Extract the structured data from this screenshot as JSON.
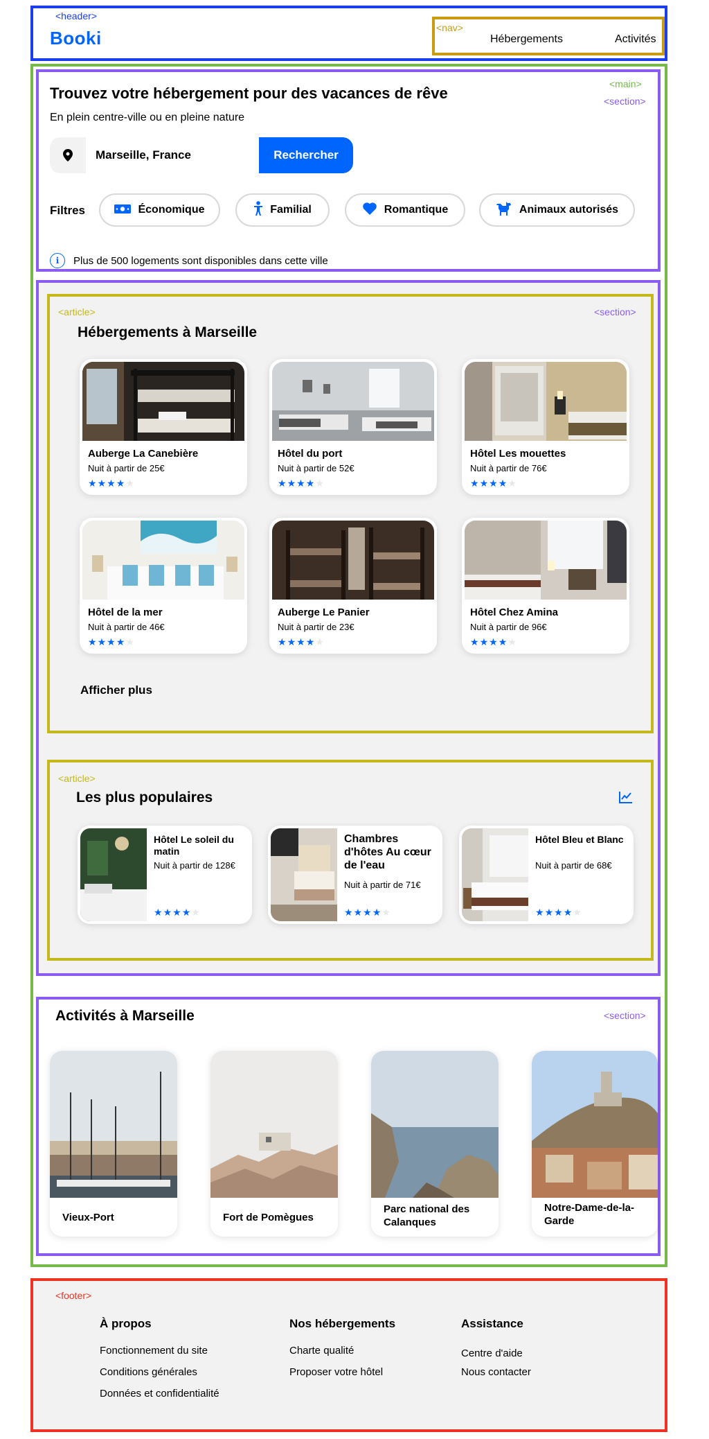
{
  "tags": {
    "header": "<header>",
    "nav": "<nav>",
    "main": "<main>",
    "section": "<section>",
    "article": "<article>",
    "footer": "<footer>"
  },
  "header": {
    "logo": "Booki",
    "nav": [
      "Hébergements",
      "Activités"
    ]
  },
  "search": {
    "title": "Trouvez votre hébergement pour des vacances de rêve",
    "subtitle": "En plein centre-ville ou en pleine nature",
    "input_value": "Marseille, France",
    "button_label": "Rechercher",
    "filters_label": "Filtres",
    "filters": [
      "Économique",
      "Familial",
      "Romantique",
      "Animaux autorisés"
    ],
    "info": "Plus de 500 logements sont disponibles dans cette ville",
    "info_icon": "i"
  },
  "accommodations": {
    "title": "Hébergements à Marseille",
    "cards": [
      {
        "name": "Auberge La Canebière",
        "price": "Nuit à partir de 25€",
        "rating": 4
      },
      {
        "name": "Hôtel du port",
        "price": "Nuit à partir de 52€",
        "rating": 4
      },
      {
        "name": "Hôtel Les mouettes",
        "price": "Nuit à partir de 76€",
        "rating": 4
      },
      {
        "name": "Hôtel de la mer",
        "price": "Nuit à partir de 46€",
        "rating": 4
      },
      {
        "name": "Auberge Le Panier",
        "price": "Nuit à partir de 23€",
        "rating": 4
      },
      {
        "name": "Hôtel Chez Amina",
        "price": "Nuit à partir de 96€",
        "rating": 4
      }
    ],
    "show_more": "Afficher plus"
  },
  "popular": {
    "title": "Les plus populaires",
    "cards": [
      {
        "name": "Hôtel Le soleil du matin",
        "price": "Nuit à partir de 128€",
        "rating": 4
      },
      {
        "name": "Chambres d'hôtes Au cœur de l'eau",
        "price": "Nuit à partir de 71€",
        "rating": 4
      },
      {
        "name": "Hôtel Bleu et Blanc",
        "price": "Nuit à partir de 68€",
        "rating": 4
      }
    ]
  },
  "activities": {
    "title": "Activités à Marseille",
    "cards": [
      {
        "name": "Vieux-Port"
      },
      {
        "name": "Fort de Pomègues"
      },
      {
        "name": "Parc national des Calanques"
      },
      {
        "name": "Notre-Dame-de-la-Garde"
      }
    ]
  },
  "footer": {
    "columns": [
      {
        "title": "À propos",
        "links": [
          "Fonctionnement du site",
          "Conditions générales",
          "Données et confidentialité"
        ]
      },
      {
        "title": "Nos hébergements",
        "links": [
          "Charte qualité",
          "Proposer votre hôtel"
        ]
      },
      {
        "title": "Assistance",
        "links": [
          "Centre d'aide",
          "Nous contacter"
        ]
      }
    ]
  },
  "colors": {
    "brand": "#0065fc",
    "header_outline": "#1a3ee8",
    "nav_outline": "#c99a12",
    "main_outline": "#74b94a",
    "section_outline": "#8b5cf0",
    "article_outline": "#c4b81a",
    "footer_outline": "#ee3222"
  }
}
